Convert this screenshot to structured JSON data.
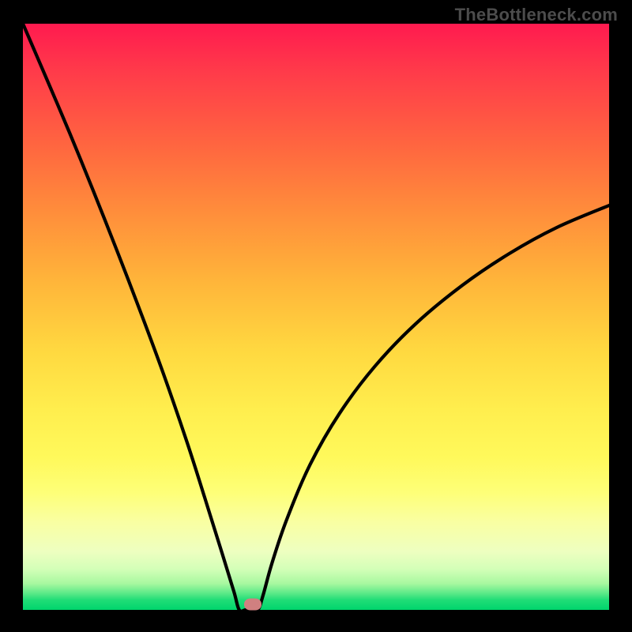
{
  "watermark": "TheBottleneck.com",
  "colors": {
    "curve": "#000000",
    "marker": "#d08080",
    "gradient_top": "#ff1a4f",
    "gradient_bottom": "#00d56c"
  },
  "chart_data": {
    "type": "line",
    "title": "",
    "xlabel": "",
    "ylabel": "",
    "xlim": [
      0,
      1
    ],
    "ylim": [
      0,
      1
    ],
    "description": "Bottleneck / deviation curve. Y is |x - optimum| mapped through a nonlinear easing so it rises steeply near the optimum, flattens toward a ceiling of 1.0 on the left edge and ~0.69 at the right edge. Background gradient encodes the same metric (green=0 good, red=1 bad).",
    "optimum_x": 0.385,
    "flat_radius": 0.016,
    "left_edge_y": 1.0,
    "right_edge_y": 0.69,
    "marker": {
      "x": 0.392,
      "y": 0.01
    },
    "series": [
      {
        "name": "bottleneck-curve",
        "x": [
          0.0,
          0.04,
          0.08,
          0.12,
          0.16,
          0.2,
          0.24,
          0.28,
          0.31,
          0.34,
          0.36,
          0.369,
          0.38,
          0.39,
          0.401,
          0.41,
          0.425,
          0.45,
          0.49,
          0.54,
          0.6,
          0.67,
          0.75,
          0.83,
          0.91,
          1.0
        ],
        "y": [
          1.0,
          0.907,
          0.813,
          0.715,
          0.614,
          0.51,
          0.402,
          0.286,
          0.192,
          0.096,
          0.031,
          0.0,
          0.0,
          0.0,
          0.0,
          0.026,
          0.08,
          0.154,
          0.248,
          0.335,
          0.415,
          0.488,
          0.554,
          0.608,
          0.652,
          0.69
        ]
      }
    ]
  }
}
